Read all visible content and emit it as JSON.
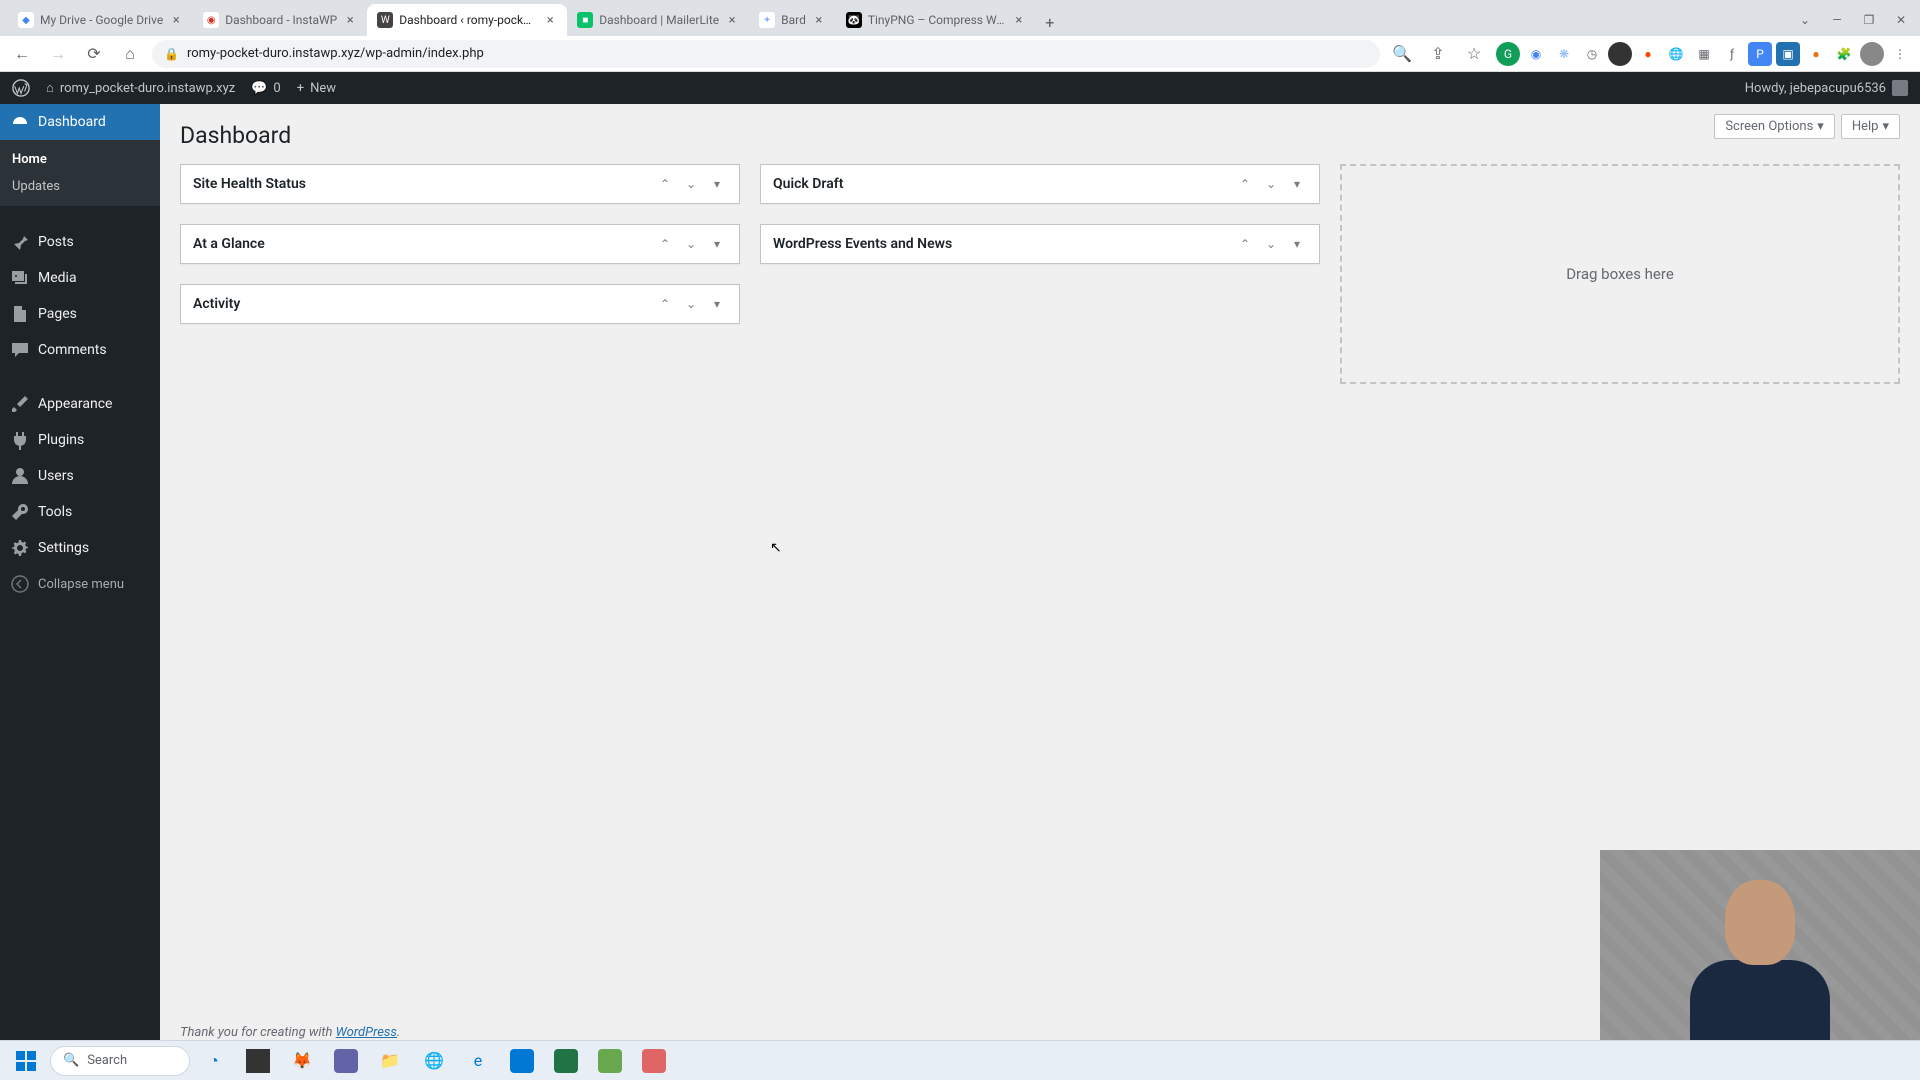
{
  "browser": {
    "tabs": [
      {
        "label": "My Drive - Google Drive",
        "fav_bg": "#0f9d58"
      },
      {
        "label": "Dashboard - InstaWP",
        "fav_bg": "#d93025"
      },
      {
        "label": "Dashboard ‹ romy-pocket-duro",
        "fav_bg": "#464342",
        "active": true
      },
      {
        "label": "Dashboard | MailerLite",
        "fav_bg": "#09c269"
      },
      {
        "label": "Bard",
        "fav_bg": "#8ab4f8"
      },
      {
        "label": "TinyPNG – Compress WebP, PNG",
        "fav_bg": "#000"
      }
    ],
    "url": "romy-pocket-duro.instawp.xyz/wp-admin/index.php"
  },
  "adminbar": {
    "site": "romy_pocket-duro.instawp.xyz",
    "comments": "0",
    "new": "New",
    "howdy": "Howdy, jebepacupu6536"
  },
  "sidebar": {
    "items": [
      {
        "label": "Dashboard",
        "icon": "dash"
      },
      {
        "label": "Posts",
        "icon": "pin"
      },
      {
        "label": "Media",
        "icon": "media"
      },
      {
        "label": "Pages",
        "icon": "page"
      },
      {
        "label": "Comments",
        "icon": "comment"
      },
      {
        "label": "Appearance",
        "icon": "brush"
      },
      {
        "label": "Plugins",
        "icon": "plug"
      },
      {
        "label": "Users",
        "icon": "user"
      },
      {
        "label": "Tools",
        "icon": "tool"
      },
      {
        "label": "Settings",
        "icon": "gear"
      }
    ],
    "submenu": [
      {
        "label": "Home",
        "current": true
      },
      {
        "label": "Updates"
      }
    ],
    "collapse": "Collapse menu"
  },
  "content": {
    "title": "Dashboard",
    "screen_options": "Screen Options",
    "help": "Help",
    "col1": [
      {
        "title": "Site Health Status"
      },
      {
        "title": "At a Glance"
      },
      {
        "title": "Activity"
      }
    ],
    "col2": [
      {
        "title": "Quick Draft"
      },
      {
        "title": "WordPress Events and News"
      }
    ],
    "dropzone": "Drag boxes here",
    "footer_prefix": "Thank you for creating with ",
    "footer_link": "WordPress"
  },
  "taskbar": {
    "search_placeholder": "Search"
  }
}
